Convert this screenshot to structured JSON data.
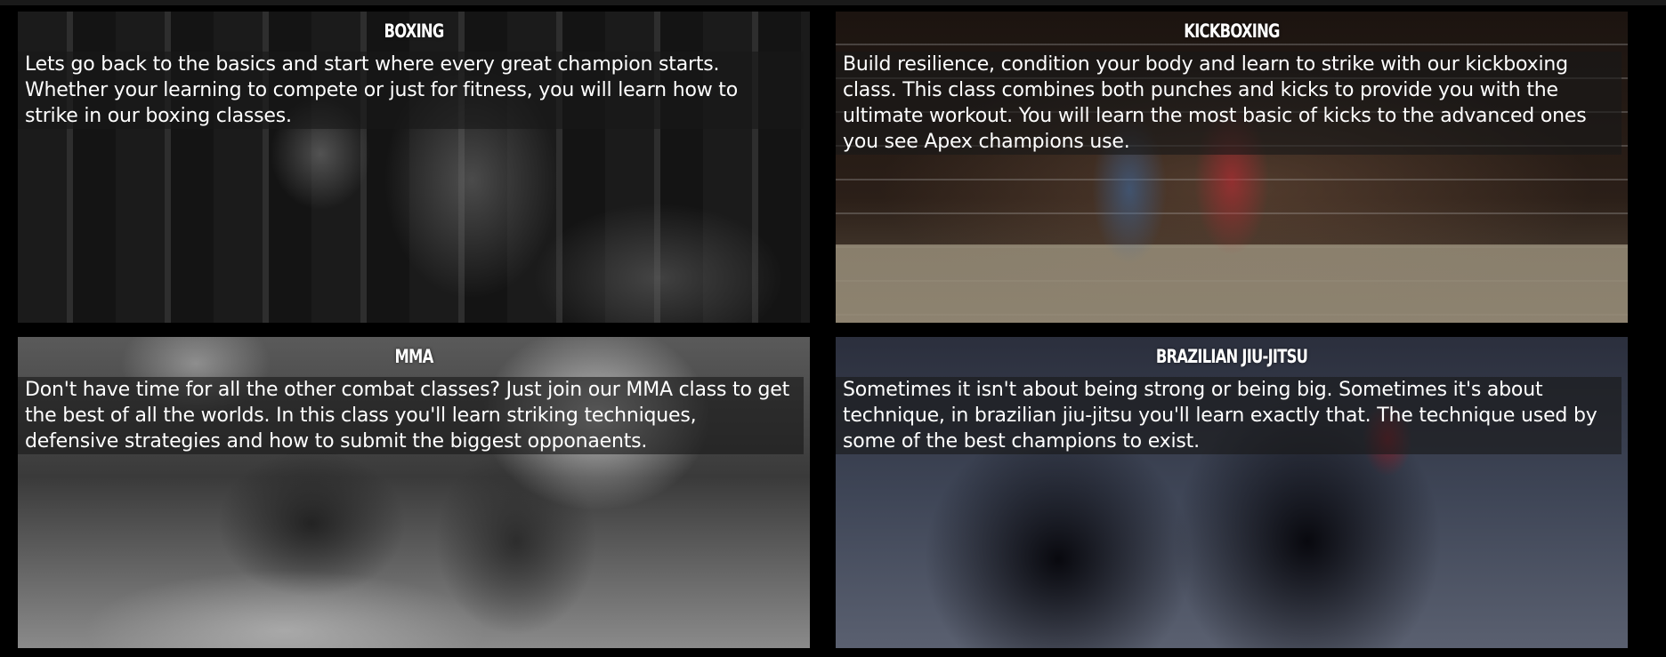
{
  "classes": [
    {
      "title": "Boxing",
      "description": "Lets go back to the basics and start where every great champion starts. Whether your learning to compete or just for fitness, you will learn how to strike in our boxing classes."
    },
    {
      "title": "Kickboxing",
      "description": "Build resilience, condition your body and learn to strike with our kickboxing class. This class combines both punches and kicks to provide you with the ultimate workout. You will learn the most basic of kicks to the advanced ones you see Apex champions use."
    },
    {
      "title": "MMA",
      "description": "Don't have time for all the other combat classes? Just join our MMA class to get the best of all the worlds. In this class you'll learn striking techniques, defensive strategies and how to submit the biggest opponaents."
    },
    {
      "title": "Brazilian Jiu-Jitsu",
      "description": "Sometimes it isn't about being strong or being big. Sometimes it's about technique, in brazilian jiu-jitsu you'll learn exactly that. The technique used by some of the best champions to exist."
    }
  ]
}
